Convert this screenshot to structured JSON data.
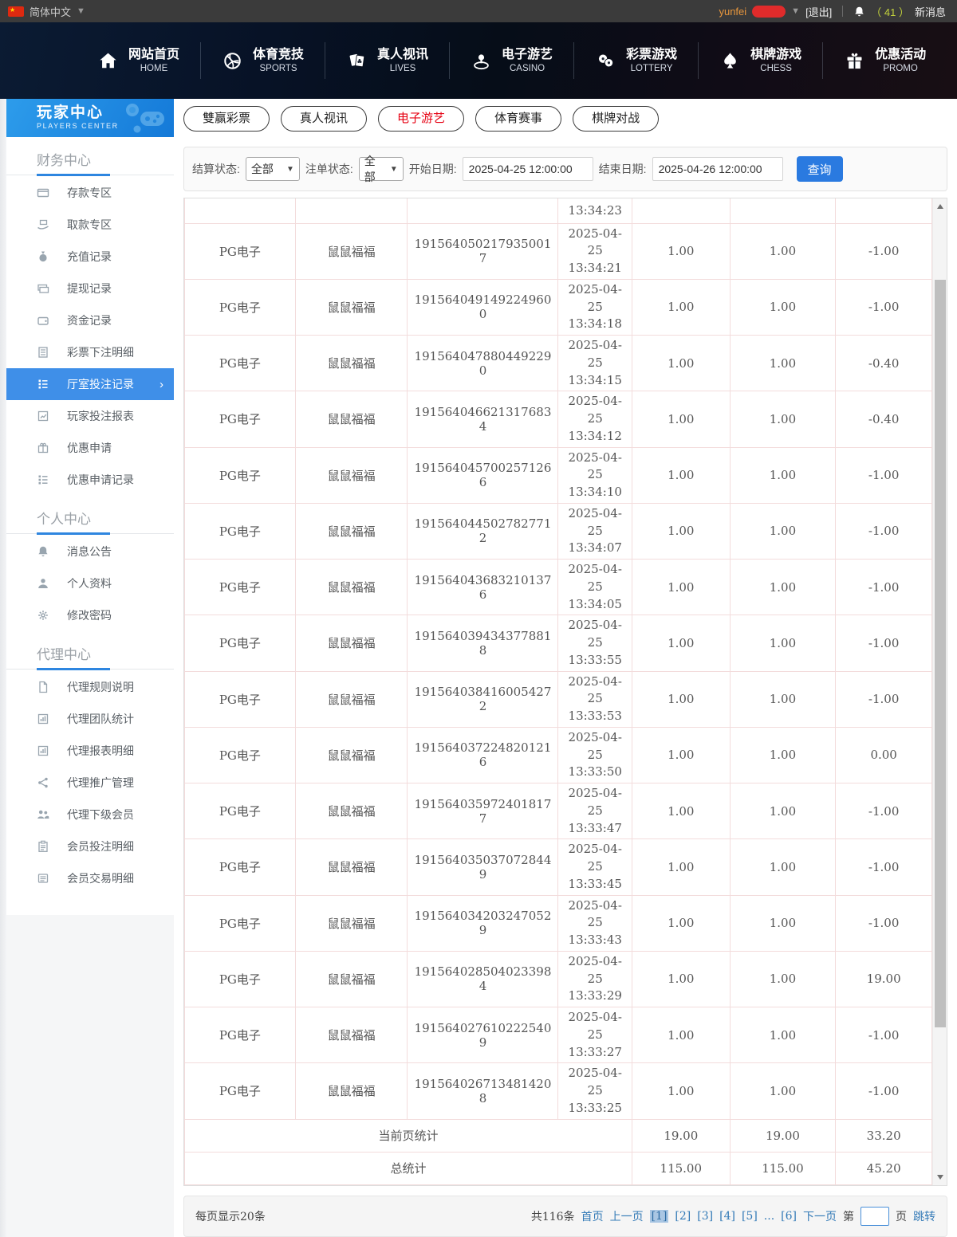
{
  "topbar": {
    "language": "简体中文",
    "username": "yunfei",
    "logout_label": "[退出]",
    "message_count": "（ 41 ）",
    "message_label": "新消息"
  },
  "nav": {
    "items": [
      {
        "zh": "网站首页",
        "en": "HOME",
        "icon": "home-icon"
      },
      {
        "zh": "体育竞技",
        "en": "SPORTS",
        "icon": "sports-ball-icon"
      },
      {
        "zh": "真人视讯",
        "en": "LIVES",
        "icon": "cards-icon"
      },
      {
        "zh": "电子游艺",
        "en": "CASINO",
        "icon": "roulette-icon"
      },
      {
        "zh": "彩票游戏",
        "en": "LOTTERY",
        "icon": "lottery-balls-icon"
      },
      {
        "zh": "棋牌游戏",
        "en": "CHESS",
        "icon": "spade-icon"
      },
      {
        "zh": "优惠活动",
        "en": "PROMO",
        "icon": "gift-icon"
      }
    ]
  },
  "sidebar": {
    "title": "玩家中心",
    "subtitle": "PLAYERS CENTER",
    "sections": [
      {
        "title": "财务中心",
        "items": [
          {
            "label": "存款专区",
            "icon": "bank-card-icon"
          },
          {
            "label": "取款专区",
            "icon": "hand-cash-icon"
          },
          {
            "label": "充值记录",
            "icon": "money-bag-icon"
          },
          {
            "label": "提现记录",
            "icon": "banknotes-icon"
          },
          {
            "label": "资金记录",
            "icon": "wallet-icon"
          },
          {
            "label": "彩票下注明细",
            "icon": "doc-lines-icon"
          },
          {
            "label": "厅室投注记录",
            "icon": "list-icon",
            "active": true,
            "arrow": "›"
          },
          {
            "label": "玩家投注报表",
            "icon": "chart-icon"
          },
          {
            "label": "优惠申请",
            "icon": "gift-box-icon"
          },
          {
            "label": "优惠申请记录",
            "icon": "list-icon"
          }
        ]
      },
      {
        "title": "个人中心",
        "items": [
          {
            "label": "消息公告",
            "icon": "bell-icon"
          },
          {
            "label": "个人资料",
            "icon": "user-icon"
          },
          {
            "label": "修改密码",
            "icon": "gear-icon"
          }
        ]
      },
      {
        "title": "代理中心",
        "items": [
          {
            "label": "代理规则说明",
            "icon": "page-icon"
          },
          {
            "label": "代理团队统计",
            "icon": "bar-chart-icon"
          },
          {
            "label": "代理报表明细",
            "icon": "bar-chart-icon"
          },
          {
            "label": "代理推广管理",
            "icon": "share-icon"
          },
          {
            "label": "代理下级会员",
            "icon": "people-icon"
          },
          {
            "label": "会员投注明细",
            "icon": "clipboard-icon"
          },
          {
            "label": "会员交易明细",
            "icon": "card-doc-icon"
          }
        ]
      }
    ]
  },
  "tabs": [
    {
      "label": "雙赢彩票",
      "active": false
    },
    {
      "label": "真人视讯",
      "active": false
    },
    {
      "label": "电子游艺",
      "active": true
    },
    {
      "label": "体育赛事",
      "active": false
    },
    {
      "label": "棋牌对战",
      "active": false
    }
  ],
  "filters": {
    "settle_status_label": "结算状态:",
    "settle_status_value": "全部",
    "order_status_label": "注单状态:",
    "order_status_value": "全部",
    "start_date_label": "开始日期:",
    "start_date_value": "2025-04-25 12:00:00",
    "end_date_label": "结束日期:",
    "end_date_value": "2025-04-26 12:00:00",
    "search_label": "查询"
  },
  "table": {
    "partial_row_time": "13:34:23",
    "rows": [
      {
        "platform": "PG电子",
        "game": "鼠鼠福福",
        "order_no": "1915640502179350017",
        "date": "2025-04-25",
        "time": "13:34:21",
        "bet": "1.00",
        "valid": "1.00",
        "winloss": "-1.00"
      },
      {
        "platform": "PG电子",
        "game": "鼠鼠福福",
        "order_no": "1915640491492249600",
        "date": "2025-04-25",
        "time": "13:34:18",
        "bet": "1.00",
        "valid": "1.00",
        "winloss": "-1.00"
      },
      {
        "platform": "PG电子",
        "game": "鼠鼠福福",
        "order_no": "1915640478804492290",
        "date": "2025-04-25",
        "time": "13:34:15",
        "bet": "1.00",
        "valid": "1.00",
        "winloss": "-0.40"
      },
      {
        "platform": "PG电子",
        "game": "鼠鼠福福",
        "order_no": "1915640466213176834",
        "date": "2025-04-25",
        "time": "13:34:12",
        "bet": "1.00",
        "valid": "1.00",
        "winloss": "-0.40"
      },
      {
        "platform": "PG电子",
        "game": "鼠鼠福福",
        "order_no": "1915640457002571266",
        "date": "2025-04-25",
        "time": "13:34:10",
        "bet": "1.00",
        "valid": "1.00",
        "winloss": "-1.00"
      },
      {
        "platform": "PG电子",
        "game": "鼠鼠福福",
        "order_no": "1915640445027827712",
        "date": "2025-04-25",
        "time": "13:34:07",
        "bet": "1.00",
        "valid": "1.00",
        "winloss": "-1.00"
      },
      {
        "platform": "PG电子",
        "game": "鼠鼠福福",
        "order_no": "1915640436832101376",
        "date": "2025-04-25",
        "time": "13:34:05",
        "bet": "1.00",
        "valid": "1.00",
        "winloss": "-1.00"
      },
      {
        "platform": "PG电子",
        "game": "鼠鼠福福",
        "order_no": "1915640394343778818",
        "date": "2025-04-25",
        "time": "13:33:55",
        "bet": "1.00",
        "valid": "1.00",
        "winloss": "-1.00"
      },
      {
        "platform": "PG电子",
        "game": "鼠鼠福福",
        "order_no": "1915640384160054272",
        "date": "2025-04-25",
        "time": "13:33:53",
        "bet": "1.00",
        "valid": "1.00",
        "winloss": "-1.00"
      },
      {
        "platform": "PG电子",
        "game": "鼠鼠福福",
        "order_no": "1915640372248201216",
        "date": "2025-04-25",
        "time": "13:33:50",
        "bet": "1.00",
        "valid": "1.00",
        "winloss": "0.00"
      },
      {
        "platform": "PG电子",
        "game": "鼠鼠福福",
        "order_no": "1915640359724018177",
        "date": "2025-04-25",
        "time": "13:33:47",
        "bet": "1.00",
        "valid": "1.00",
        "winloss": "-1.00"
      },
      {
        "platform": "PG电子",
        "game": "鼠鼠福福",
        "order_no": "1915640350370728449",
        "date": "2025-04-25",
        "time": "13:33:45",
        "bet": "1.00",
        "valid": "1.00",
        "winloss": "-1.00"
      },
      {
        "platform": "PG电子",
        "game": "鼠鼠福福",
        "order_no": "1915640342032470529",
        "date": "2025-04-25",
        "time": "13:33:43",
        "bet": "1.00",
        "valid": "1.00",
        "winloss": "-1.00"
      },
      {
        "platform": "PG电子",
        "game": "鼠鼠福福",
        "order_no": "1915640285040233984",
        "date": "2025-04-25",
        "time": "13:33:29",
        "bet": "1.00",
        "valid": "1.00",
        "winloss": "19.00"
      },
      {
        "platform": "PG电子",
        "game": "鼠鼠福福",
        "order_no": "1915640276102225409",
        "date": "2025-04-25",
        "time": "13:33:27",
        "bet": "1.00",
        "valid": "1.00",
        "winloss": "-1.00"
      },
      {
        "platform": "PG电子",
        "game": "鼠鼠福福",
        "order_no": "1915640267134814208",
        "date": "2025-04-25",
        "time": "13:33:25",
        "bet": "1.00",
        "valid": "1.00",
        "winloss": "-1.00"
      }
    ],
    "page_summary": {
      "label": "当前页统计",
      "bet": "19.00",
      "valid": "19.00",
      "winloss": "33.20"
    },
    "total_summary": {
      "label": "总统计",
      "bet": "115.00",
      "valid": "115.00",
      "winloss": "45.20"
    }
  },
  "pagination": {
    "per_page": "每页显示20条",
    "total": "共116条",
    "links": [
      {
        "label": "首页",
        "type": "link"
      },
      {
        "label": "上一页",
        "type": "link"
      },
      {
        "label": "[1]",
        "type": "page",
        "current": true
      },
      {
        "label": "[2]",
        "type": "page"
      },
      {
        "label": "[3]",
        "type": "page"
      },
      {
        "label": "[4]",
        "type": "page"
      },
      {
        "label": "[5]",
        "type": "page"
      },
      {
        "label": "...",
        "type": "ellipsis"
      },
      {
        "label": "[6]",
        "type": "page"
      },
      {
        "label": "下一页",
        "type": "link"
      }
    ],
    "jump_prefix": "第",
    "jump_suffix": "页",
    "jump_button": "跳转"
  },
  "colors": {
    "primary_blue": "#2a7ae0",
    "active_item_blue": "#3f8fe8",
    "link_blue": "#337ab7",
    "tab_active_red": "#e60012",
    "table_border_pink": "#f3dcdc",
    "topbar_gray": "#3b3b3b"
  }
}
